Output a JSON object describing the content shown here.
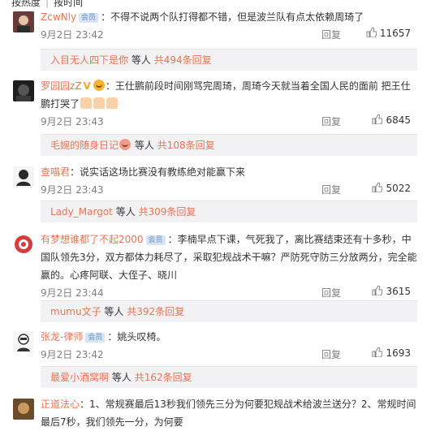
{
  "sort": {
    "hot": "按热度",
    "time": "按时间"
  },
  "comments": [
    {
      "user": "ZcwNly",
      "text": "：不得不说两个队打得都不错，但是波兰队有点太依赖周琦了",
      "time": "9月2日 23:42",
      "reply": "回复",
      "likes": "11657",
      "sub_user": "入目无人四下是你",
      "sub_mid": "等人",
      "sub_count": "共494条回复"
    },
    {
      "user": "罗园园zZ",
      "text": "：王仕鹏前段时间刚骂完周琦，周琦今天就当着全国人民的面前 把王仕鹏打哭了",
      "time": "9月2日 23:43",
      "reply": "回复",
      "likes": "6845",
      "sub_user": "毛婉的随身日记",
      "sub_mid": "等人",
      "sub_count": "共108条回复"
    },
    {
      "user": "查喵君",
      "text": "：说实话这场比赛没有教练绝对能赢下来",
      "time": "9月2日 23:43",
      "reply": "回复",
      "likes": "5022",
      "sub_user": "Lady_Margot",
      "sub_mid": "等人",
      "sub_count": "共309条回复"
    },
    {
      "user": "有梦想谁都了不起2000",
      "text": "：李楠早点下课，气死我了，离比赛结束还有十多秒，中国队领先3分，双方都体力耗尽了，采取犯规战术干嘛？严防死守防三分放两分，完全能赢的。心疼阿联、大侄子、晓川",
      "time": "9月2日 23:44",
      "reply": "回复",
      "likes": "3615",
      "sub_user": "mumu文子",
      "sub_mid": "等人",
      "sub_count": "共392条回复"
    },
    {
      "user": "张龙-律师",
      "text": "：姚头叹椅。",
      "time": "9月2日 23:42",
      "reply": "回复",
      "likes": "1693",
      "sub_user": "最爱小酒窝啊",
      "sub_mid": "等人",
      "sub_count": "共162条回复"
    },
    {
      "user": "正道法心",
      "text": "：1、常规赛最后13秒我们领先三分为何要犯规战术给波兰送分？2、常规时间最后7秒，我们领先一分，为何要",
      "time": "",
      "reply": "",
      "likes": "",
      "sub_user": "",
      "sub_mid": "",
      "sub_count": ""
    }
  ],
  "colors": {
    "accent": "#eb7350",
    "vip_badge": "#d6e4f5",
    "sub_bg": "#f2f2f5"
  },
  "icons": {
    "like": "thumbs-up-icon",
    "vip": "vip-badge-icon"
  }
}
